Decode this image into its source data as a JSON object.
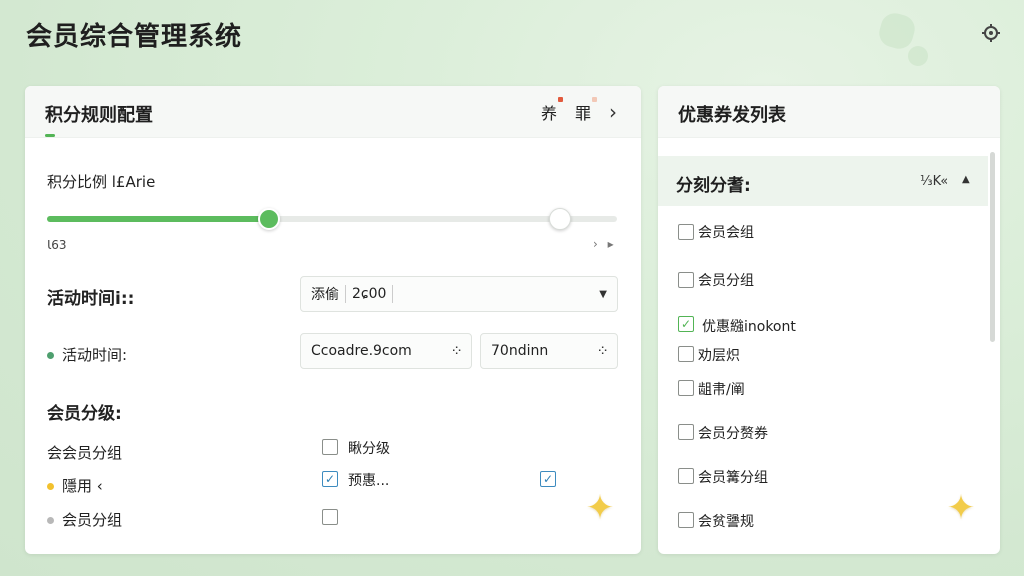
{
  "app": {
    "title": "会员综合管理系统",
    "settings_icon": "refresh-gear-icon"
  },
  "colors": {
    "accent_green": "#5cbc5e",
    "bullet_green": "#4e9f6e",
    "bullet_yellow": "#f2c12e",
    "bullet_gray": "#b8b8b8",
    "star_yellow": "#f2cc4a",
    "dot_red": "#e25a3d"
  },
  "left_panel": {
    "title": "积分规则配置",
    "header_actions": [
      "养",
      "罪"
    ],
    "header_chevron": "›",
    "ratio_label": "积分比例 l£Arie",
    "slider": {
      "value": 0.39,
      "max_handle": 0.9
    },
    "slider_value_text": "Ɩ63",
    "slider_nav": "› ▸",
    "activity_time_label_1": "活动时间i::",
    "select": {
      "left": "添偷",
      "right": "2ɕ00"
    },
    "activity_time_label_2": "活动时间:",
    "date_input_1": "Ccoadre.9com",
    "date_input_2": "70ndinn",
    "member_level_title": "会员分级:",
    "levels": [
      {
        "label": "会会员分组",
        "bullet": ""
      },
      {
        "label": "隱用 ‹",
        "bullet": "yellow"
      },
      {
        "label": "会员分组",
        "bullet": "gray"
      }
    ],
    "options": [
      {
        "label": "瞅分级",
        "checked": false
      },
      {
        "label": "预惠...",
        "checked": true
      },
      {
        "label": "",
        "checked": false
      }
    ],
    "extra_checked": true,
    "star_icon": "sparkle-star-icon"
  },
  "right_panel": {
    "title": "优惠券发列表",
    "filter_label": "分刻分耆:",
    "filter_mark": "⅓K«",
    "filter_caret": "▲",
    "items": [
      {
        "label": "会员会组",
        "checked": false
      },
      {
        "label": "会员分组",
        "checked": false
      },
      {
        "label": "优惠繈inokont",
        "checked": true
      },
      {
        "label": "劝层炽",
        "checked": false
      },
      {
        "label": "龃帇/阐",
        "checked": false
      },
      {
        "label": "会员分赘券",
        "checked": false
      },
      {
        "label": "会员篝分组",
        "checked": false
      },
      {
        "label": "会贫謽规",
        "checked": false
      }
    ],
    "star_icon": "sparkle-star-icon"
  }
}
